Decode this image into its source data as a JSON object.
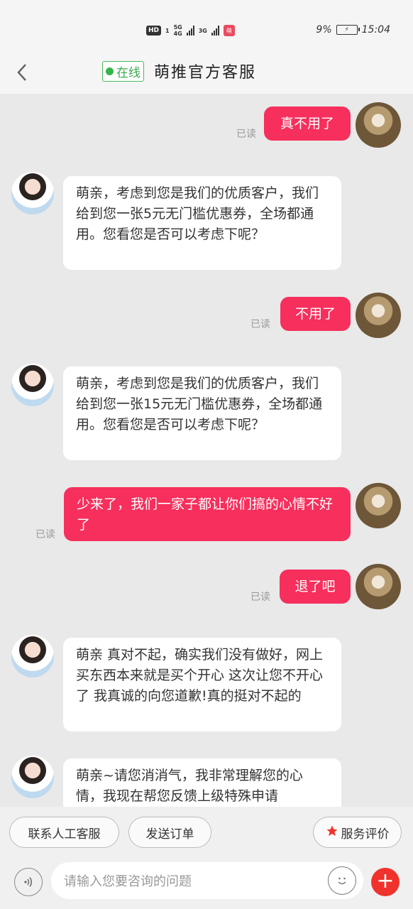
{
  "status_bar": {
    "hd": "HD",
    "sim1": "1",
    "net1": "5G",
    "net1_sub": "4G",
    "net2": "3G",
    "battery": "9%",
    "time": "15:04"
  },
  "header": {
    "back_icon": "chevron-left-icon",
    "online": "在线",
    "title": "萌推官方客服"
  },
  "messages": [
    {
      "from": "user",
      "text": "真不用了",
      "status": "已读"
    },
    {
      "from": "agent",
      "text": "萌亲，考虑到您是我们的优质客户，我们给到您一张5元无门槛优惠券，全场都通用。您看您是否可以考虑下呢？"
    },
    {
      "from": "user",
      "text": "不用了",
      "status": "已读"
    },
    {
      "from": "agent",
      "text": "萌亲，考虑到您是我们的优质客户，我们给到您一张15元无门槛优惠券，全场都通用。您看您是否可以考虑下呢？"
    },
    {
      "from": "user",
      "text": "少来了，我们一家子都让你们搞的心情不好了",
      "status": "已读"
    },
    {
      "from": "user",
      "text": "退了吧",
      "status": "已读"
    },
    {
      "from": "agent",
      "text": "萌亲 真对不起，确实我们没有做好，网上买东西本来就是买个开心 这次让您不开心了 我真诚的向您道歉!真的挺对不起的"
    },
    {
      "from": "agent",
      "text": "萌亲~请您消消气，我非常理解您的心情，我现在帮您反馈上级特殊申请"
    }
  ],
  "quick_actions": {
    "human": "联系人工客服",
    "order": "发送订单",
    "rate": "服务评价"
  },
  "input": {
    "placeholder": "请输入您要咨询的问题"
  },
  "colors": {
    "user_bubble": "#f62f5c",
    "online_green": "#35b44a",
    "plus_red": "#f0322c"
  }
}
